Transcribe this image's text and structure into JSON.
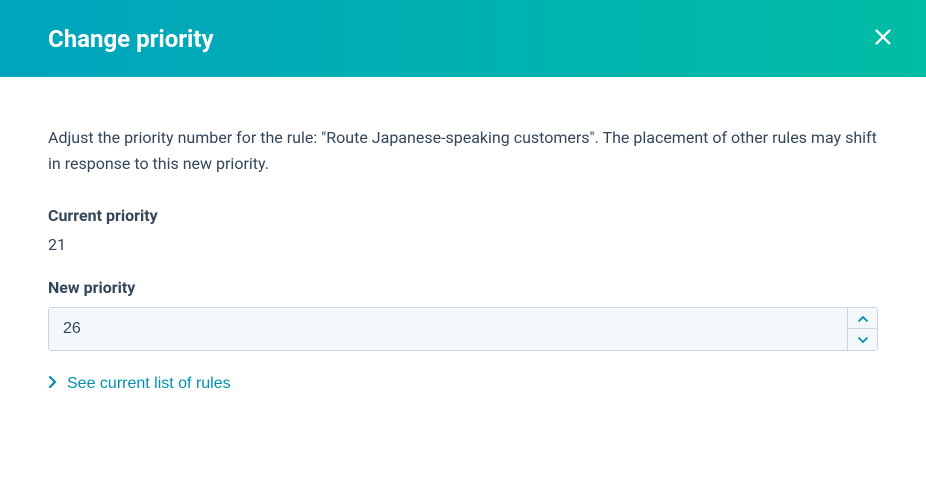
{
  "header": {
    "title": "Change priority"
  },
  "body": {
    "description": "Adjust the priority number for the rule: \"Route Japanese-speaking customers\". The placement of other rules may shift in response to this new priority.",
    "current_priority": {
      "label": "Current priority",
      "value": "21"
    },
    "new_priority": {
      "label": "New priority",
      "value": "26"
    },
    "expand_link": "See current list of rules"
  }
}
